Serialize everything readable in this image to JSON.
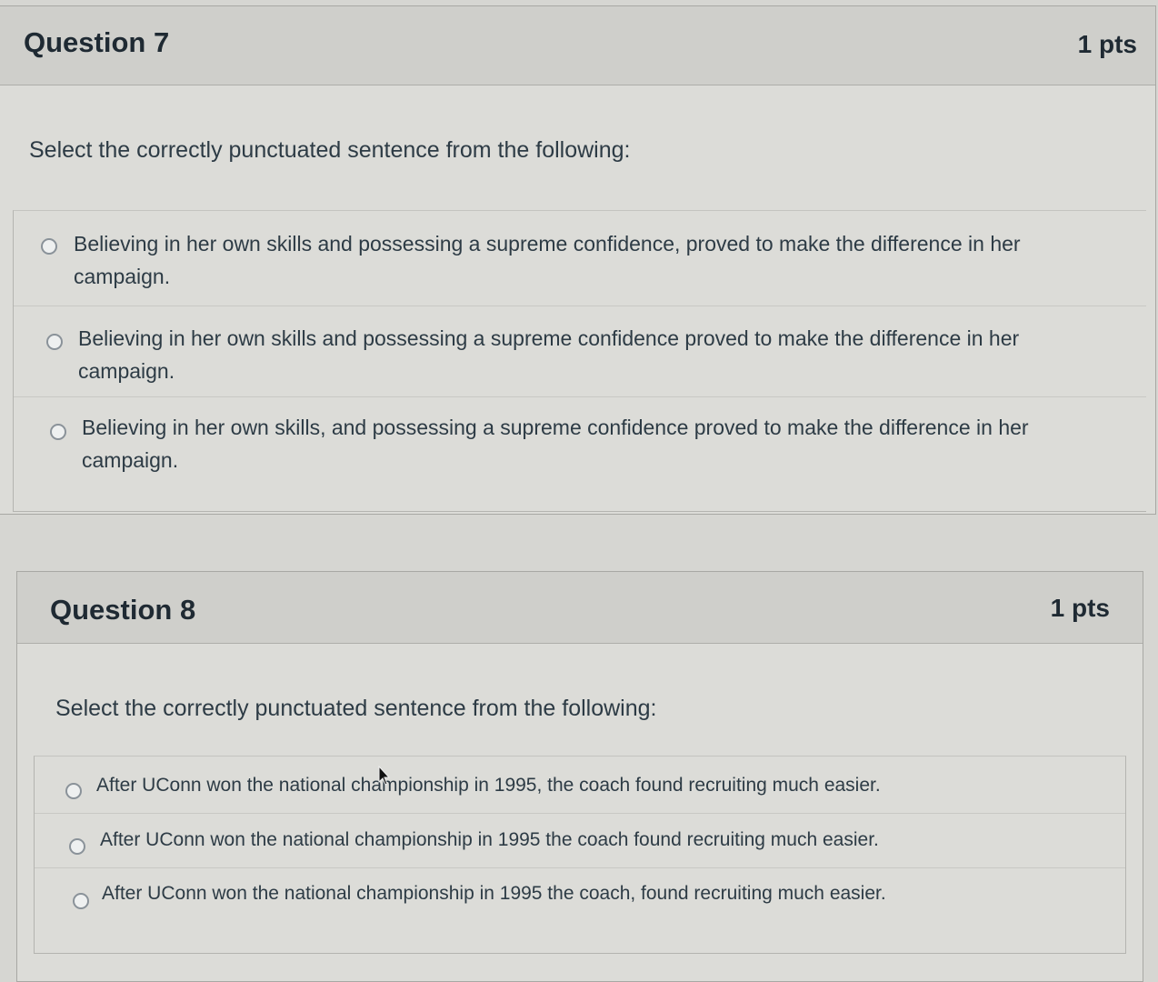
{
  "questions": [
    {
      "title": "Question 7",
      "points": "1 pts",
      "prompt": "Select the correctly punctuated sentence from the following:",
      "answers": [
        "Believing in her own skills and possessing a supreme confidence, proved to make the difference in her campaign.",
        "Believing in her own skills and possessing a supreme confidence proved to make the difference in her campaign.",
        "Believing in her own skills, and possessing a supreme confidence proved to make the difference in her campaign."
      ]
    },
    {
      "title": "Question 8",
      "points": "1 pts",
      "prompt": "Select the correctly punctuated sentence from the following:",
      "answers": [
        "After UConn won the national championship in 1995, the coach found recruiting much easier.",
        "After UConn won the national championship in 1995 the coach found recruiting much easier.",
        "After UConn won the national championship in 1995 the coach, found recruiting much easier."
      ]
    }
  ],
  "colors": {
    "page_background": "#d6d6d2",
    "header_background": "#cfcfcb",
    "text": "#2d3b45"
  },
  "icons": {
    "cursor": "mouse-pointer-icon",
    "radio": "radio-button-icon"
  }
}
